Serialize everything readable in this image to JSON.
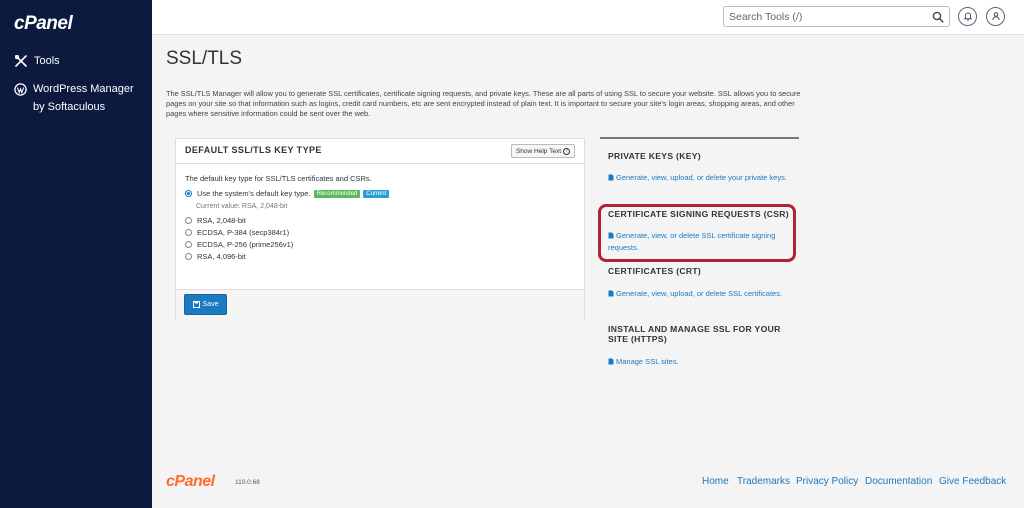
{
  "sidebar": {
    "logo": "cPanel",
    "items": [
      {
        "label": "Tools",
        "icon": "tools-icon"
      },
      {
        "label": "WordPress Manager by Softaculous",
        "icon": "wordpress-icon"
      }
    ]
  },
  "topbar": {
    "search_placeholder": "Search Tools (/)"
  },
  "page": {
    "title": "SSL/TLS",
    "intro": "The SSL/TLS Manager will allow you to generate SSL certificates, certificate signing requests, and private keys. These are all parts of using SSL to secure your website. SSL allows you to secure pages on your site so that information such as logins, credit card numbers, etc are sent encrypted instead of plain text. It is important to secure your site's login areas, shopping areas, and other pages where sensitive information could be sent over the web."
  },
  "panel": {
    "title": "DEFAULT SSL/TLS KEY TYPE",
    "help_button": "Show Help Text",
    "description": "The default key type for SSL/TLS certificates and CSRs.",
    "options": [
      {
        "label": "Use the system's default key type.",
        "selected": true
      },
      {
        "label": "RSA, 2,048-bit",
        "selected": false
      },
      {
        "label": "ECDSA, P-384 (secp384r1)",
        "selected": false
      },
      {
        "label": "ECDSA, P-256 (prime256v1)",
        "selected": false
      },
      {
        "label": "RSA, 4,096-bit",
        "selected": false
      }
    ],
    "badge_recommended": "Recommended",
    "badge_current": "Current",
    "current_value": "Current value: RSA, 2,048-bit",
    "save_label": "Save"
  },
  "right": {
    "sections": [
      {
        "heading": "PRIVATE KEYS (KEY)",
        "link": "Generate, view, upload, or delete your private keys."
      },
      {
        "heading": "CERTIFICATE SIGNING REQUESTS (CSR)",
        "link": "Generate, view, or delete SSL certificate signing requests."
      },
      {
        "heading": "CERTIFICATES (CRT)",
        "link": "Generate, view, upload, or delete SSL certificates."
      },
      {
        "heading": "INSTALL AND MANAGE SSL FOR YOUR SITE (HTTPS)",
        "link": "Manage SSL sites."
      }
    ],
    "highlight_color": "#b3203a"
  },
  "footer": {
    "logo": "cPanel",
    "version": "110.0.68",
    "links": [
      "Home",
      "Trademarks",
      "Privacy Policy",
      "Documentation",
      "Give Feedback"
    ]
  },
  "colors": {
    "sidebar_bg": "#0d1a40",
    "link": "#1a7ac2",
    "footer_logo": "#ff6c2c"
  }
}
